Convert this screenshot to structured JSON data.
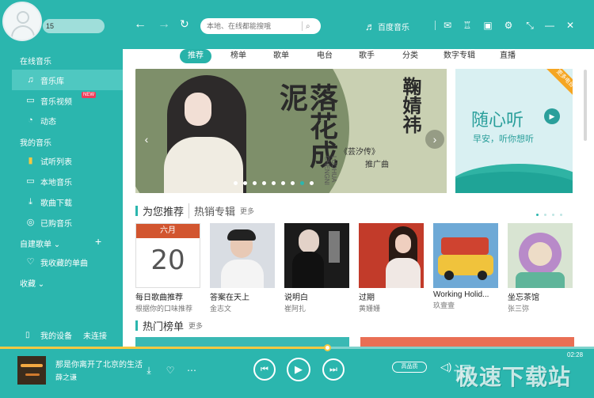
{
  "user": {
    "name": "15"
  },
  "sidebar": {
    "section_online": "在线音乐",
    "items_online": [
      {
        "label": "音乐库",
        "icon": "music-note-icon"
      },
      {
        "label": "音乐视频",
        "icon": "tv-icon",
        "badge": "NEW"
      },
      {
        "label": "动态",
        "icon": "activity-icon"
      }
    ],
    "section_mine": "我的音乐",
    "items_mine": [
      {
        "label": "试听列表",
        "icon": "bars-icon"
      },
      {
        "label": "本地音乐",
        "icon": "monitor-icon"
      },
      {
        "label": "歌曲下载",
        "icon": "download-icon"
      },
      {
        "label": "已购音乐",
        "icon": "purchased-icon"
      }
    ],
    "section_playlists": "自建歌单",
    "section_fav": "我收藏的单曲",
    "section_collect": "收藏",
    "device": {
      "label": "我的设备",
      "status": "未连接"
    }
  },
  "search": {
    "placeholder": "本地、在线都能搜哦"
  },
  "brand": {
    "name": "百度音乐"
  },
  "tabs": [
    "推荐",
    "榜单",
    "歌单",
    "电台",
    "歌手",
    "分类",
    "数字专辑",
    "直播"
  ],
  "banner": {
    "title": "落花成泥",
    "subtitle": "鞠婧祎",
    "tag1": "《芸汐传》",
    "tag2": "推广曲",
    "pinyin": "LUOHUA CHENGNI",
    "side_title": "随心听",
    "side_sub": "早安，听你想听",
    "side_corner": "更多电台"
  },
  "section1": {
    "title": "为您推荐",
    "title2": "热销专辑",
    "more": "更多"
  },
  "albums": [
    {
      "name": "每日歌曲推荐",
      "artist": "根据你的口味推荐",
      "cal_month": "六月",
      "cal_day": "20"
    },
    {
      "name": "答案在天上",
      "artist": "金志文",
      "cover": "#d9dde3"
    },
    {
      "name": "说明白",
      "artist": "崔阿扎",
      "cover": "#1b1b1b"
    },
    {
      "name": "过期",
      "artist": "黄姗姗",
      "cover": "#c23b2a"
    },
    {
      "name": "Working Holid...",
      "artist": "玖壹壹",
      "cover": "#6ea9d6"
    },
    {
      "name": "坐忘茶馆",
      "artist": "张三弥",
      "cover": "#d8e4d2"
    }
  ],
  "section2": {
    "title": "热门榜单",
    "more": "更多"
  },
  "player": {
    "title": "那是你离开了北京的生活",
    "artist": "薛之谦",
    "time": "02:28",
    "progress": 0.55,
    "quality": "高品质",
    "lyric_text": "词",
    "watermark": "极速下载站"
  }
}
